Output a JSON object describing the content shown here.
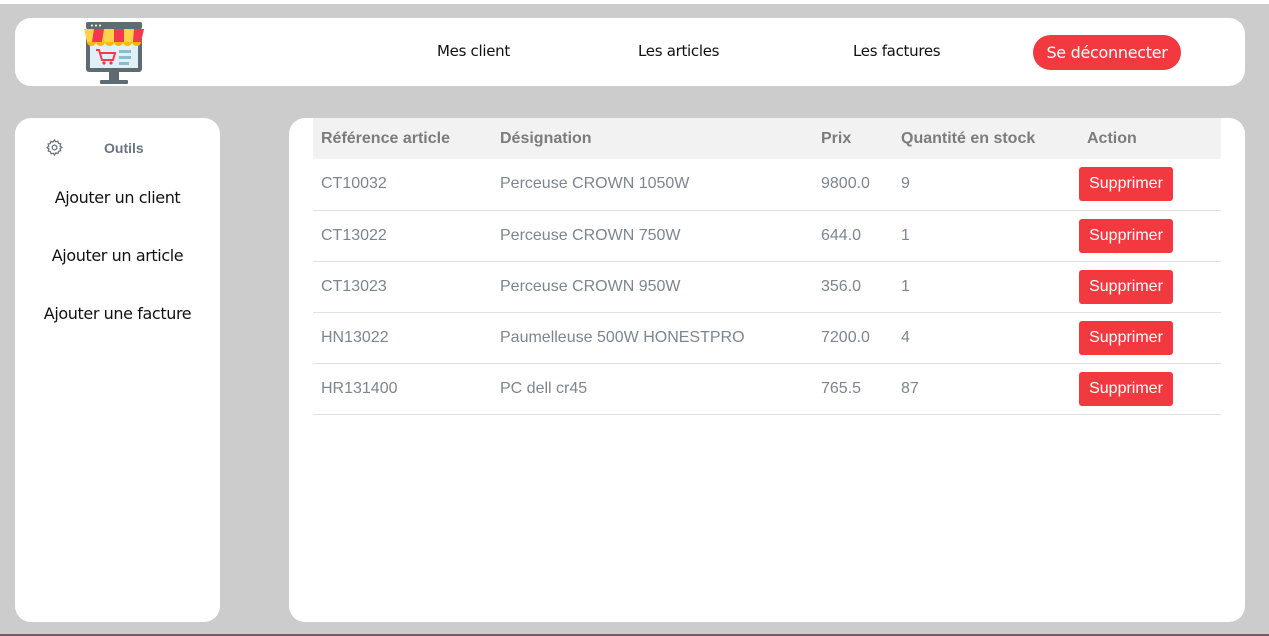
{
  "header": {
    "logo_icon": "shop-computer-icon",
    "nav": [
      {
        "label": "Mes client"
      },
      {
        "label": "Les articles"
      },
      {
        "label": "Les factures"
      }
    ],
    "logout_label": "Se déconnecter"
  },
  "sidebar": {
    "gear_icon": "gear-icon",
    "tools_label": "Outils",
    "items": [
      {
        "label": "Ajouter un client"
      },
      {
        "label": "Ajouter un article"
      },
      {
        "label": "Ajouter une facture"
      }
    ]
  },
  "table": {
    "columns": [
      "Référence article",
      "Désignation",
      "Prix",
      "Quantité en stock",
      "Action"
    ],
    "rows": [
      {
        "ref": "CT10032",
        "designation": "Perceuse CROWN 1050W",
        "prix": "9800.0",
        "qte": "9",
        "action": "Supprimer"
      },
      {
        "ref": "CT13022",
        "designation": "Perceuse CROWN 750W",
        "prix": "644.0",
        "qte": "1",
        "action": "Supprimer"
      },
      {
        "ref": "CT13023",
        "designation": "Perceuse CROWN 950W",
        "prix": "356.0",
        "qte": "1",
        "action": "Supprimer"
      },
      {
        "ref": "HN13022",
        "designation": "Paumelleuse 500W HONESTPRO",
        "prix": "7200.0",
        "qte": "4",
        "action": "Supprimer"
      },
      {
        "ref": "HR131400",
        "designation": "PC dell cr45",
        "prix": "765.5",
        "qte": "87",
        "action": "Supprimer"
      }
    ]
  },
  "colors": {
    "accent": "#f2393f",
    "background": "#cccccc",
    "muted_text": "#7d8591"
  }
}
